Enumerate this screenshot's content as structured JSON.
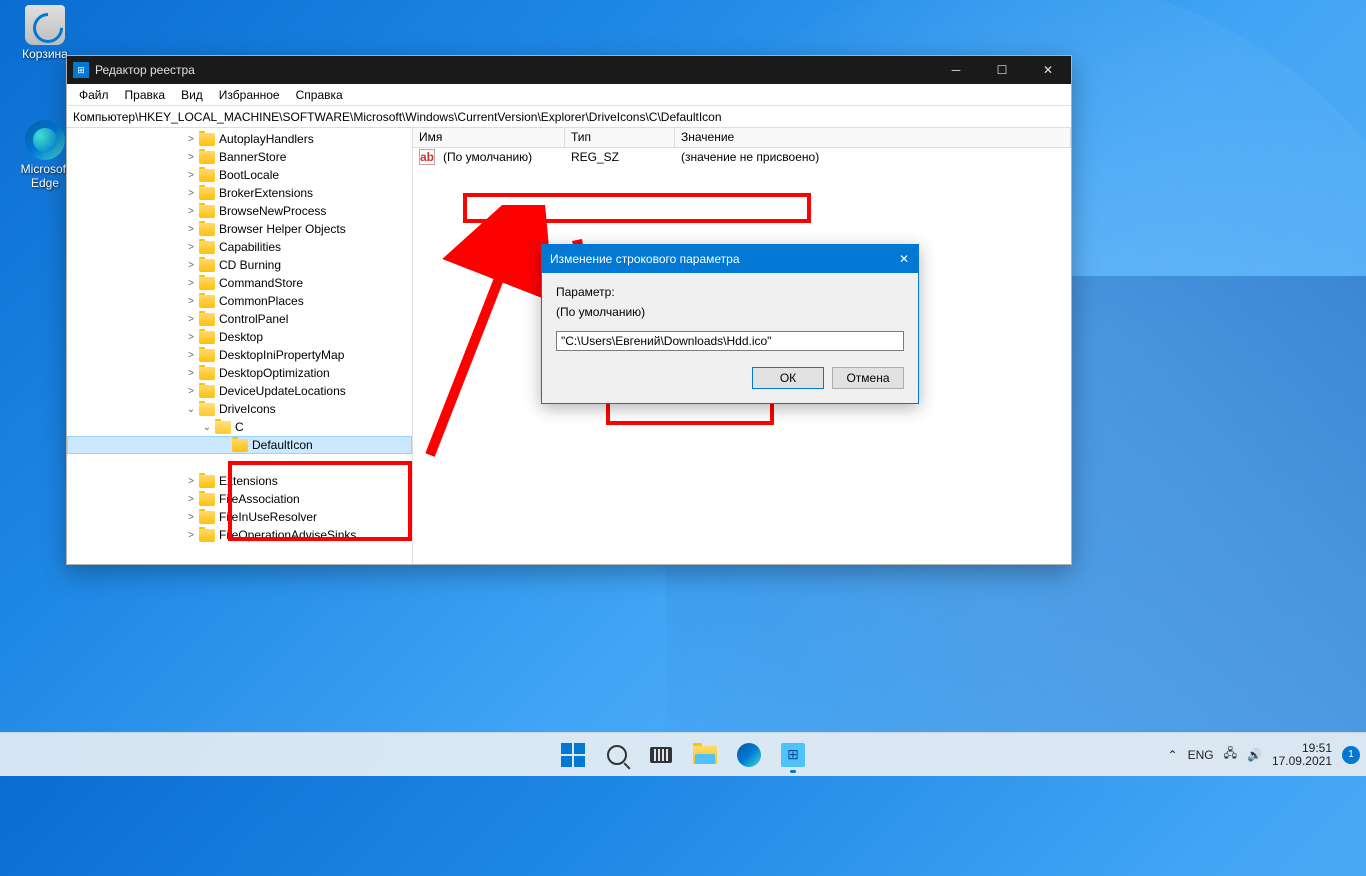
{
  "desktop": {
    "recycle_bin": "Корзина",
    "edge": "Microsoft Edge"
  },
  "window": {
    "title": "Редактор реестра",
    "menu": [
      "Файл",
      "Правка",
      "Вид",
      "Избранное",
      "Справка"
    ],
    "address": "Компьютер\\HKEY_LOCAL_MACHINE\\SOFTWARE\\Microsoft\\Windows\\CurrentVersion\\Explorer\\DriveIcons\\C\\DefaultIcon",
    "tree": [
      "AutoplayHandlers",
      "BannerStore",
      "BootLocale",
      "BrokerExtensions",
      "BrowseNewProcess",
      "Browser Helper Objects",
      "Capabilities",
      "CD Burning",
      "CommandStore",
      "CommonPlaces",
      "ControlPanel",
      "Desktop",
      "DesktopIniPropertyMap",
      "DesktopOptimization",
      "DeviceUpdateLocations"
    ],
    "drive_icons": "DriveIcons",
    "drive_c": "C",
    "default_icon": "DefaultIcon",
    "tree_after": [
      "Extensions",
      "FileAssociation",
      "FileInUseResolver",
      "FileOperationAdviseSinks"
    ],
    "columns": {
      "name": "Имя",
      "type": "Тип",
      "data": "Значение"
    },
    "value_row": {
      "name": "(По умолчанию)",
      "type": "REG_SZ",
      "data": "(значение не присвоено)"
    }
  },
  "dialog": {
    "title": "Изменение строкового параметра",
    "param_label": "Параметр:",
    "param_value": "(По умолчанию)",
    "input_value": "\"C:\\Users\\Евгений\\Downloads\\Hdd.ico\"",
    "ok": "ОК",
    "cancel": "Отмена"
  },
  "taskbar": {
    "lang": "ENG",
    "time": "19:51",
    "date": "17.09.2021",
    "notifications": "1"
  }
}
